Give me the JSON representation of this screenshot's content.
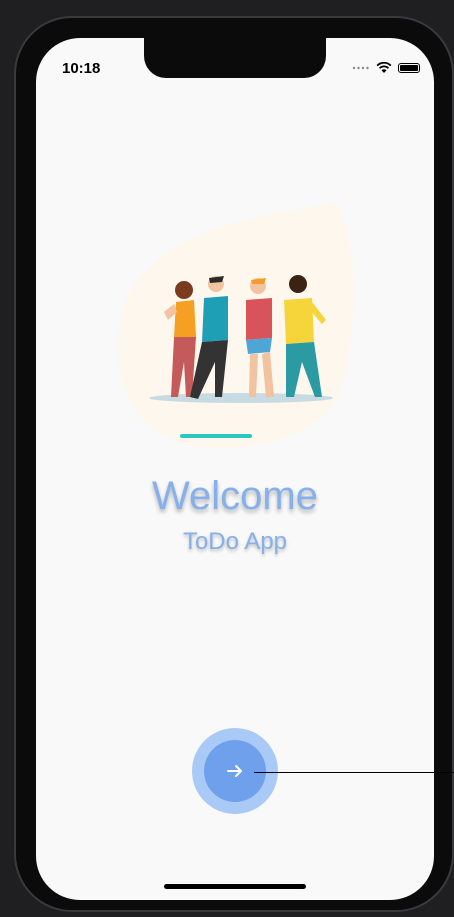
{
  "status_bar": {
    "time": "10:18"
  },
  "welcome": {
    "title": "Welcome",
    "subtitle": "ToDo App"
  },
  "next_button": {
    "icon": "arrow-right-icon"
  },
  "colors": {
    "accent": "#86b0ec",
    "button_outer": "#a9c9f6",
    "button_inner": "#6fa0ec",
    "screen_bg": "#f9f9f9"
  }
}
